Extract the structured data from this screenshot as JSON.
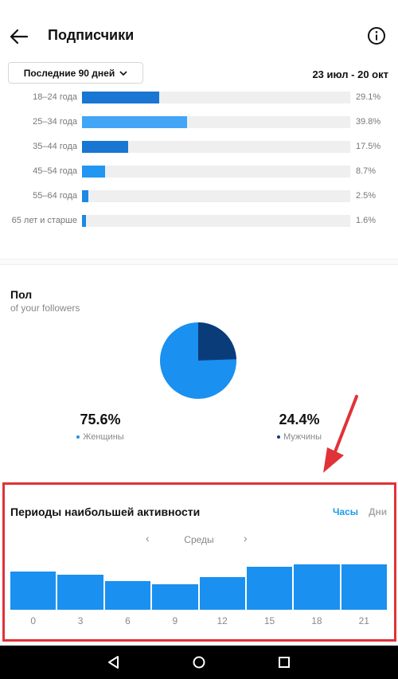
{
  "header": {
    "title": "Подписчики",
    "back_icon": "back-arrow-icon",
    "info_icon": "info-icon"
  },
  "filter": {
    "period_label": "Последние 90 дней",
    "date_range": "23 июл - 20 окт"
  },
  "age_groups": [
    {
      "label": "18–24 года",
      "percent_text": "29.1%",
      "value": 29.1,
      "color": "#1976d2"
    },
    {
      "label": "25–34 года",
      "percent_text": "39.8%",
      "value": 39.8,
      "color": "#42a5f5"
    },
    {
      "label": "35–44 года",
      "percent_text": "17.5%",
      "value": 17.5,
      "color": "#1976d2"
    },
    {
      "label": "45–54 года",
      "percent_text": "8.7%",
      "value": 8.7,
      "color": "#2196f3"
    },
    {
      "label": "55–64 года",
      "percent_text": "2.5%",
      "value": 2.5,
      "color": "#1e88e5"
    },
    {
      "label": "65 лет и старше",
      "percent_text": "1.6%",
      "value": 1.6,
      "color": "#1e88e5"
    }
  ],
  "gender": {
    "title": "Пол",
    "subtitle": "of your followers",
    "women": {
      "value_text": "75.6%",
      "label": "Женщины",
      "value": 75.6,
      "color": "#1a90f0"
    },
    "men": {
      "value_text": "24.4%",
      "label": "Мужчины",
      "value": 24.4,
      "color": "#0b3c7a"
    }
  },
  "activity": {
    "title": "Периоды наибольшей активности",
    "tab_hours": "Часы",
    "tab_days": "Дни",
    "day": "Среды",
    "hour_labels": [
      "0",
      "3",
      "6",
      "9",
      "12",
      "15",
      "18",
      "21"
    ]
  },
  "chart_data": {
    "type": "bar",
    "categories": [
      "0",
      "3",
      "6",
      "9",
      "12",
      "15",
      "18",
      "21"
    ],
    "values": [
      72,
      66,
      55,
      49,
      62,
      82,
      87,
      87
    ],
    "ylim": [
      0,
      100
    ],
    "color": "#1a90f0"
  },
  "colors": {
    "accent": "#1a9be8",
    "highlight_box": "#e13238"
  },
  "navbar": {
    "icons": [
      "back-triangle-icon",
      "home-circle-icon",
      "recents-square-icon"
    ]
  }
}
